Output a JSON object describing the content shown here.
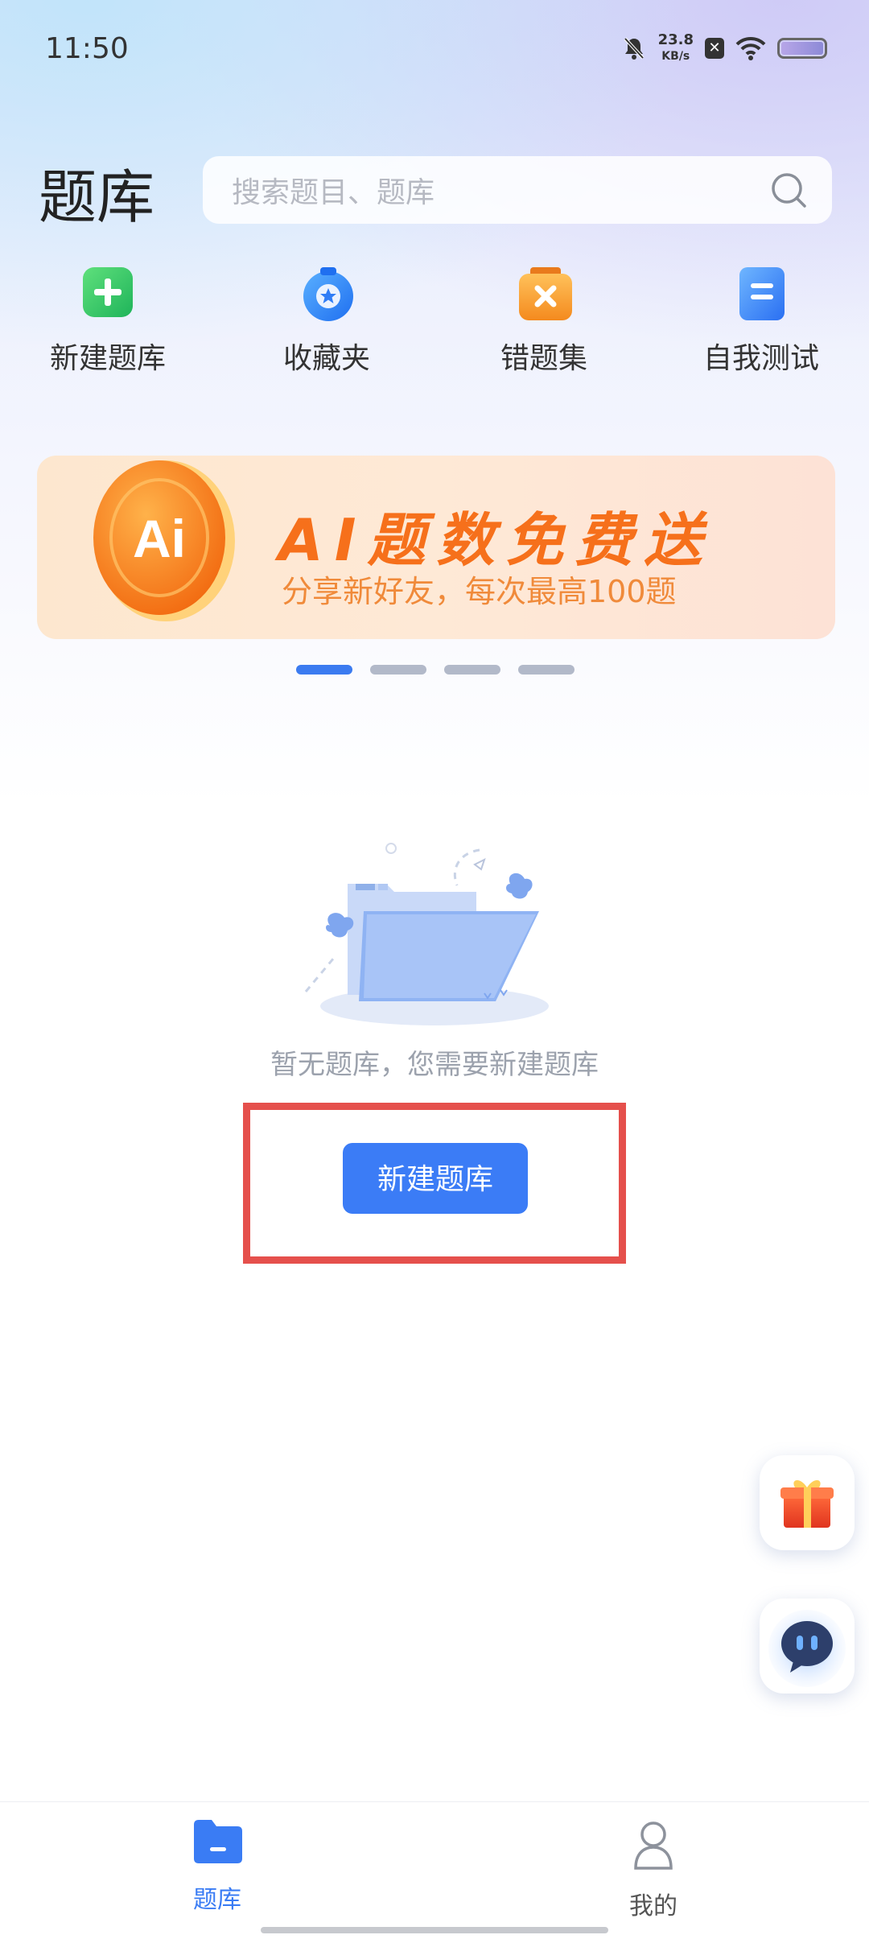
{
  "status_bar": {
    "time": "11:50",
    "net_speed_value": "23.8",
    "net_speed_unit": "KB/s",
    "icons": [
      "bell-muted-icon",
      "close-badge-icon",
      "wifi-icon",
      "battery-icon"
    ]
  },
  "header": {
    "title": "题库",
    "search_placeholder": "搜索题目、题库"
  },
  "quick_actions": [
    {
      "label": "新建题库",
      "icon": "plus-icon",
      "color": "#34c759"
    },
    {
      "label": "收藏夹",
      "icon": "star-icon",
      "color": "#2f7df6"
    },
    {
      "label": "错题集",
      "icon": "wrong-mark-icon",
      "color": "#f8a33a"
    },
    {
      "label": "自我测试",
      "icon": "document-icon",
      "color": "#3b8bf7"
    }
  ],
  "banner": {
    "coin_text": "Ai",
    "title": "AI题数免费送",
    "subtitle": "分享新好友，每次最高100题",
    "page_count": 4,
    "active_page": 1
  },
  "empty_state": {
    "message": "暂无题库，您需要新建题库",
    "button_label": "新建题库"
  },
  "floating_buttons": [
    "gift-icon",
    "chat-bot-icon"
  ],
  "bottom_nav": {
    "items": [
      {
        "label": "题库",
        "icon": "folder-icon",
        "active": true
      },
      {
        "label": "我的",
        "icon": "user-icon",
        "active": false
      }
    ]
  },
  "colors": {
    "accent": "#3b7cf6",
    "highlight_border": "#e5504c",
    "banner_orange": "#f6701b"
  }
}
